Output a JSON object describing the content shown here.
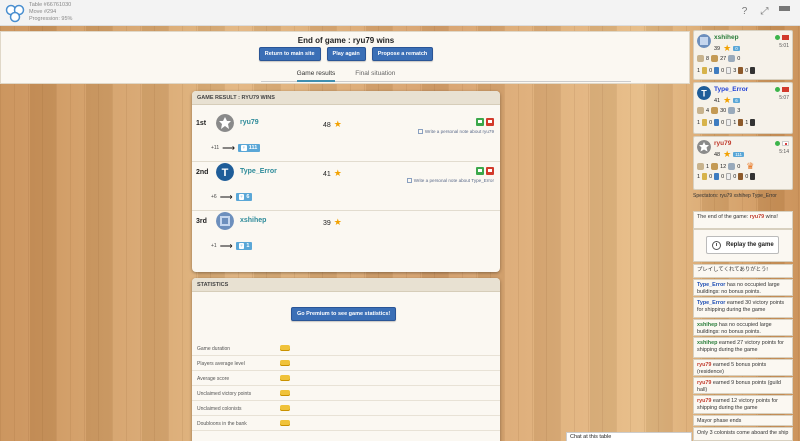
{
  "topbar": {
    "table": "Table #66761030",
    "move": "Move #294",
    "progression": "Progression: 95%"
  },
  "header": {
    "end_title": "End of game : ryu79 wins",
    "buttons": [
      "Return to main site",
      "Play again",
      "Propose a rematch"
    ],
    "tabs": [
      "Game results",
      "Final situation"
    ]
  },
  "result_card": {
    "title": "GAME RESULT : RYU79 WINS",
    "rows": [
      {
        "rank": "1st",
        "name": "ryu79",
        "score": "48",
        "note": "Write a personal note about ryu79",
        "elo_delta": "+11",
        "elo": "111",
        "color": "#2e8b9a"
      },
      {
        "rank": "2nd",
        "name": "Type_Error",
        "score": "41",
        "note": "Write a personal note about Type_Error",
        "elo_delta": "+6",
        "elo": "6",
        "color": "#2e8b9a"
      },
      {
        "rank": "3rd",
        "name": "xshihep",
        "score": "39",
        "note": "",
        "elo_delta": "+1",
        "elo": "1",
        "color": "#2e8b9a"
      }
    ]
  },
  "statistics": {
    "title": "STATISTICS",
    "premium_button": "Go Premium to see game statistics!",
    "rows": [
      "Game duration",
      "Players average level",
      "Average score",
      "Unclaimed victory points",
      "Unclaimed colonists",
      "Doubloons in the bank"
    ]
  },
  "players": [
    {
      "name": "xshihep",
      "name_color": "#2a7d3a",
      "vp": "39",
      "elo": "0",
      "time": "5:01",
      "line2": [
        "8",
        "27",
        "0"
      ],
      "line3": [
        "1",
        "0",
        "0",
        "3",
        "0"
      ]
    },
    {
      "name": "Type_Error",
      "name_color": "#1f3fd6",
      "vp": "41",
      "elo": "6",
      "time": "5:07",
      "line2": [
        "4",
        "30",
        "3"
      ],
      "line3": [
        "1",
        "0",
        "0",
        "1",
        "1"
      ]
    },
    {
      "name": "ryu79",
      "name_color": "#c0392b",
      "vp": "48",
      "elo": "111",
      "time": "5:14",
      "line2": [
        "1",
        "12",
        "0"
      ],
      "line3": [
        "1",
        "0",
        "0",
        "0",
        "0"
      ]
    }
  ],
  "spectators": {
    "label": "Spectators:",
    "names": "ryu79  xshihep  Type_Error"
  },
  "log": {
    "end_text": "The end of the game: ",
    "end_winner": "ryu79",
    "end_suffix": " wins!",
    "replay": "Replay the game",
    "jp_message": "プレイしてくれてありがとう!",
    "entries": [
      {
        "name": "Type_Error",
        "color": "blue",
        "text": " has no occupied large buildings: no bonus points."
      },
      {
        "name": "Type_Error",
        "color": "blue",
        "text": " earned 30 victory points for shipping during the game"
      },
      {
        "name": "xshihep",
        "color": "green",
        "text": " has no occupied large buildings: no bonus points."
      },
      {
        "name": "xshihep",
        "color": "green",
        "text": " earned 27 victory points for shipping during the game"
      },
      {
        "name": "ryu79",
        "color": "red",
        "text": " earned 5 bonus points (residence)"
      },
      {
        "name": "ryu79",
        "color": "red",
        "text": " earned 9 bonus points (guild hall)"
      },
      {
        "name": "ryu79",
        "color": "red",
        "text": " earned 12 victory points for shipping during the game"
      }
    ],
    "mayor": "Mayor phase ends",
    "last": "Only 3 colonists come aboard the ship"
  },
  "chat": {
    "label": "Chat at this table"
  }
}
